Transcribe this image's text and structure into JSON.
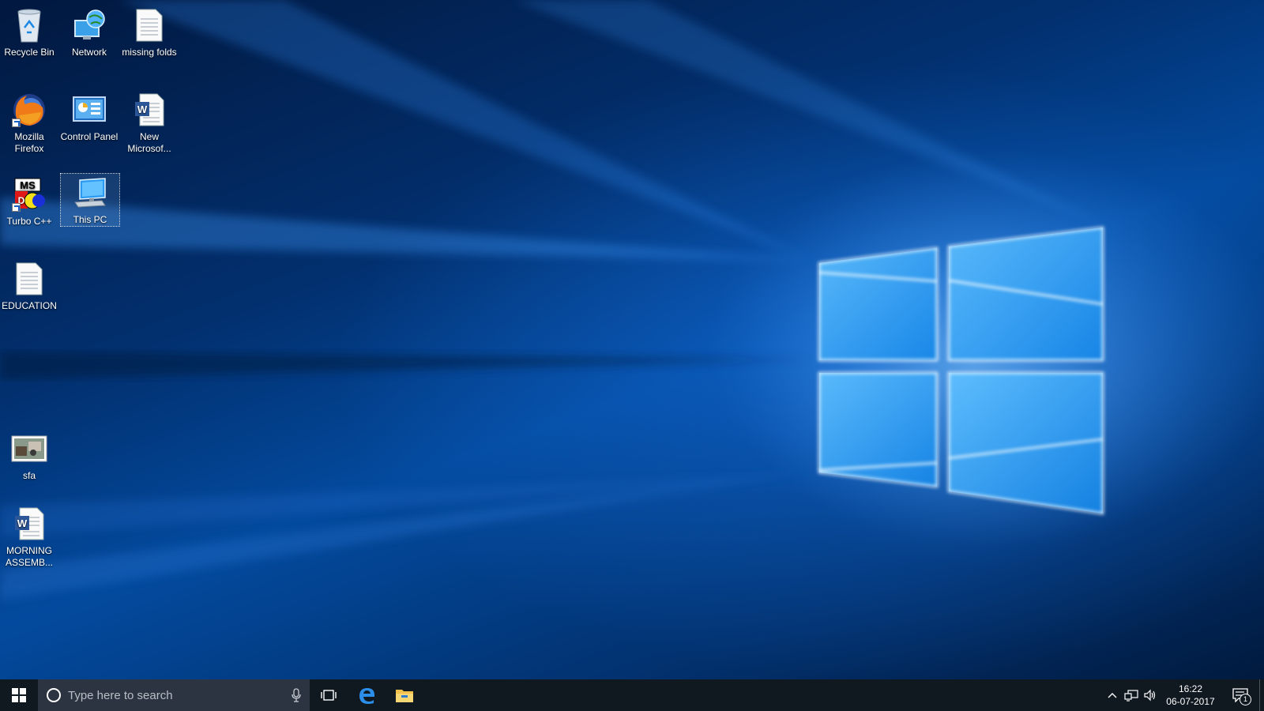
{
  "desktop": {
    "icons": [
      {
        "label": "Recycle Bin",
        "icon": "recycle-bin-icon"
      },
      {
        "label": "Network",
        "icon": "network-icon"
      },
      {
        "label": "missing folds",
        "icon": "text-document-icon"
      },
      {
        "label": "Mozilla Firefox",
        "icon": "firefox-icon"
      },
      {
        "label": "Control Panel",
        "icon": "control-panel-icon"
      },
      {
        "label": "New Microsof...",
        "icon": "word-document-icon"
      },
      {
        "label": "Turbo C++",
        "icon": "turbo-cpp-icon"
      },
      {
        "label": "This PC",
        "icon": "computer-icon"
      },
      {
        "label": "EDUCATION",
        "icon": "text-document-icon"
      },
      {
        "label": "sfa",
        "icon": "image-thumbnail-icon"
      },
      {
        "label": "MORNING ASSEMB...",
        "icon": "word-document-icon"
      }
    ],
    "selected": "This PC"
  },
  "taskbar": {
    "search_placeholder": "Type here to search",
    "pinned": [
      "edge-icon",
      "file-explorer-icon"
    ],
    "clock_time": "16:22",
    "clock_date": "06-07-2017",
    "notification_count": "1"
  },
  "colors": {
    "taskbar_bg": "#101820",
    "search_bg": "#2b3440",
    "accent": "#1b6fd8"
  }
}
